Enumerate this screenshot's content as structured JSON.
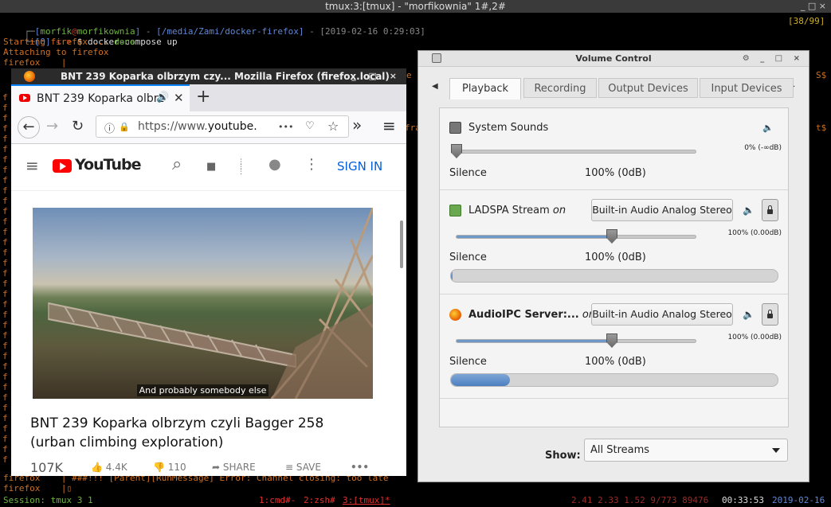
{
  "terminal": {
    "window_title": "tmux:3:[tmux] - \"morfikownia\" 1#,2#",
    "window_controls": "_ □ ×",
    "pane_counter": "[38/99]",
    "prompt_user": "morfik",
    "prompt_at": "@",
    "prompt_host": "morfikownia",
    "prompt_path": "[/media/Zami/docker-firefox]",
    "prompt_time": "[2019-02-16 0:29:03]",
    "prompt_status": "[0]",
    "prompt_arrows": "< >",
    "command": "$ docker-compose up",
    "line_starting": "Starting firefox ... ",
    "line_done": "done",
    "line_attaching": "Attaching to firefox",
    "line_firefox": "firefox    |",
    "gutter_char": "f",
    "gutter_e": "e",
    "right_fra": "fra",
    "right_s": "S$",
    "right_t": "t$",
    "bottom_line": "firefox    | ###!!! [Parent][RunMessage] Error: Channel closing: too late",
    "bottom_prompt": "firefox    |",
    "status_session": "Session: tmux 3 1",
    "status_win1": "1:cmd#-",
    "status_win2": "2:zsh#",
    "status_win3": "3:[tmux]*",
    "status_load": "2.41 2.33 1.52 9/773 89476",
    "status_time": "00:33:53",
    "status_date": "2019-02-16"
  },
  "firefox": {
    "title": "BNT 239 Koparka olbrzym czy... Mozilla Firefox (firefox.local)",
    "window_controls": "_ □ ×",
    "tab_title": "BNT 239 Koparka olbrz",
    "tab_audio_icon": "🔊",
    "tab_close": "✕",
    "new_tab": "+",
    "url_prefix": "https://www.",
    "url_domain": "youtube.",
    "url_more": "•••",
    "nav_back": "←",
    "nav_forward": "→",
    "nav_reload": "↻",
    "overflow": "»",
    "menu": "≡",
    "lock": "🔒",
    "info": "ⓘ",
    "pocket": "♡",
    "star": "☆",
    "yt_menu": "≡",
    "yt_name": "YouTube",
    "yt_search": "⌕",
    "yt_camera": "■",
    "yt_apps": "⋮⋮⋮",
    "yt_msg": "●",
    "yt_more": "⋮",
    "sign_in": "SIGN IN",
    "caption": "And probably somebody else",
    "video_title": "BNT 239 Koparka olbrzym czyli Bagger 258 (urban climbing exploration)",
    "views": "107K",
    "likes": "4.4K",
    "dislikes": "110",
    "share": "SHARE",
    "save": "SAVE",
    "more": "•••"
  },
  "volume_control": {
    "title": "Volume Control",
    "window_controls": "⚙ _ □ ×",
    "tab_prev": "◀",
    "tab_next": "▶",
    "tabs": [
      "Playback",
      "Recording",
      "Output Devices",
      "Input Devices"
    ],
    "active_tab": "Playback",
    "streams": [
      {
        "name": "System Sounds",
        "on": "",
        "device": "",
        "percent": "0% (-∞dB)",
        "level": 0.0,
        "peak": null,
        "left": "Silence",
        "mid": "100% (0dB)"
      },
      {
        "name": "LADSPA Stream",
        "on": "on",
        "device": "Built-in Audio Analog Stereo",
        "percent": "100% (0.00dB)",
        "level": 0.65,
        "peak": 0.005,
        "left": "Silence",
        "mid": "100% (0dB)"
      },
      {
        "name": "AudioIPC Server:...",
        "on": "on",
        "device": "Built-in Audio Analog Stereo",
        "percent": "100% (0.00dB)",
        "level": 0.65,
        "peak": 0.18,
        "left": "Silence",
        "mid": "100% (0dB)"
      }
    ],
    "mute_icon": "🔈",
    "show_label": "Show:",
    "show_value": "All Streams"
  },
  "colors": {
    "accent": "#0a84ff",
    "youtube_red": "#ff0000",
    "slider_fill": "#6d98c8"
  }
}
